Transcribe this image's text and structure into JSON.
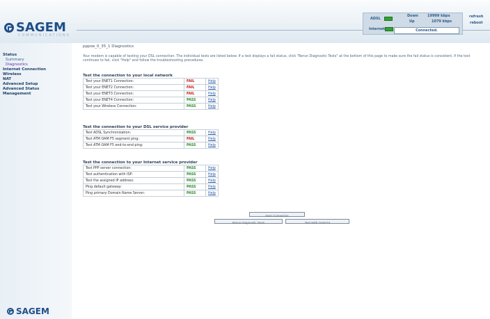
{
  "brand": {
    "name": "SAGEM",
    "subtitle": "COMMUNICATIONS"
  },
  "status_panel": {
    "adsl_label": "ADSL",
    "down_label": "Down",
    "down_value": "19999 kbps",
    "up_label": "Up",
    "up_value": "1079 kbps",
    "internet_label": "Internet",
    "connected": "Connected.",
    "refresh": "refresh",
    "reboot": "reboot"
  },
  "sidebar": {
    "items": [
      {
        "label": "Status"
      },
      {
        "label": "Summary",
        "sub": true
      },
      {
        "label": "Diagnostics",
        "sub": true,
        "active": true
      },
      {
        "label": "Internet Connection"
      },
      {
        "label": "Wireless"
      },
      {
        "label": "NAT"
      },
      {
        "label": "Advanced Setup"
      },
      {
        "label": "Advanced Status"
      },
      {
        "label": "Management"
      }
    ]
  },
  "main": {
    "page_title": "pppoe_0_35_1 Diagnostics",
    "intro": "Your modem is capable of testing your DSL connection. The individual tests are listed below. If a test displays a fail status, click \"Rerun Diagnostic Tests\" at the bottom of this page to make sure the fail status is consistent. If the test continues to fail, click \"Help\" and follow the troubleshooting procedures.",
    "sections": [
      {
        "title": "Test the connection to your local network",
        "rows": [
          {
            "name": "Test your ENET1 Connection:",
            "status": "FAIL",
            "help": "Help"
          },
          {
            "name": "Test your ENET2 Connection:",
            "status": "FAIL",
            "help": "Help"
          },
          {
            "name": "Test your ENET3 Connection:",
            "status": "FAIL",
            "help": "Help"
          },
          {
            "name": "Test your ENET4 Connection:",
            "status": "PASS",
            "help": "Help"
          },
          {
            "name": "Test your Wireless Connection:",
            "status": "PASS",
            "help": "Help"
          }
        ]
      },
      {
        "title": "Test the connection to your DSL service provider",
        "rows": [
          {
            "name": "Test ADSL Synchronization:",
            "status": "PASS",
            "help": "Help"
          },
          {
            "name": "Test ATM OAM F5 segment ping:",
            "status": "FAIL",
            "help": "Help"
          },
          {
            "name": "Test ATM OAM F5 end-to-end ping:",
            "status": "PASS",
            "help": "Help"
          }
        ]
      },
      {
        "title": "Test the connection to your Internet service provider",
        "rows": [
          {
            "name": "Test PPP server connection:",
            "status": "PASS",
            "help": "Help"
          },
          {
            "name": "Test authentication with ISP:",
            "status": "PASS",
            "help": "Help"
          },
          {
            "name": "Test the assigned IP address:",
            "status": "PASS",
            "help": "Help"
          },
          {
            "name": "Ping default gateway:",
            "status": "PASS",
            "help": "Help"
          },
          {
            "name": "Ping primary Domain Name Server:",
            "status": "PASS",
            "help": "Help"
          }
        ]
      }
    ],
    "buttons": {
      "next": "Next Connection",
      "rerun": "Rerun Diagnostic Tests",
      "oam": "Test With OAM F4"
    }
  }
}
